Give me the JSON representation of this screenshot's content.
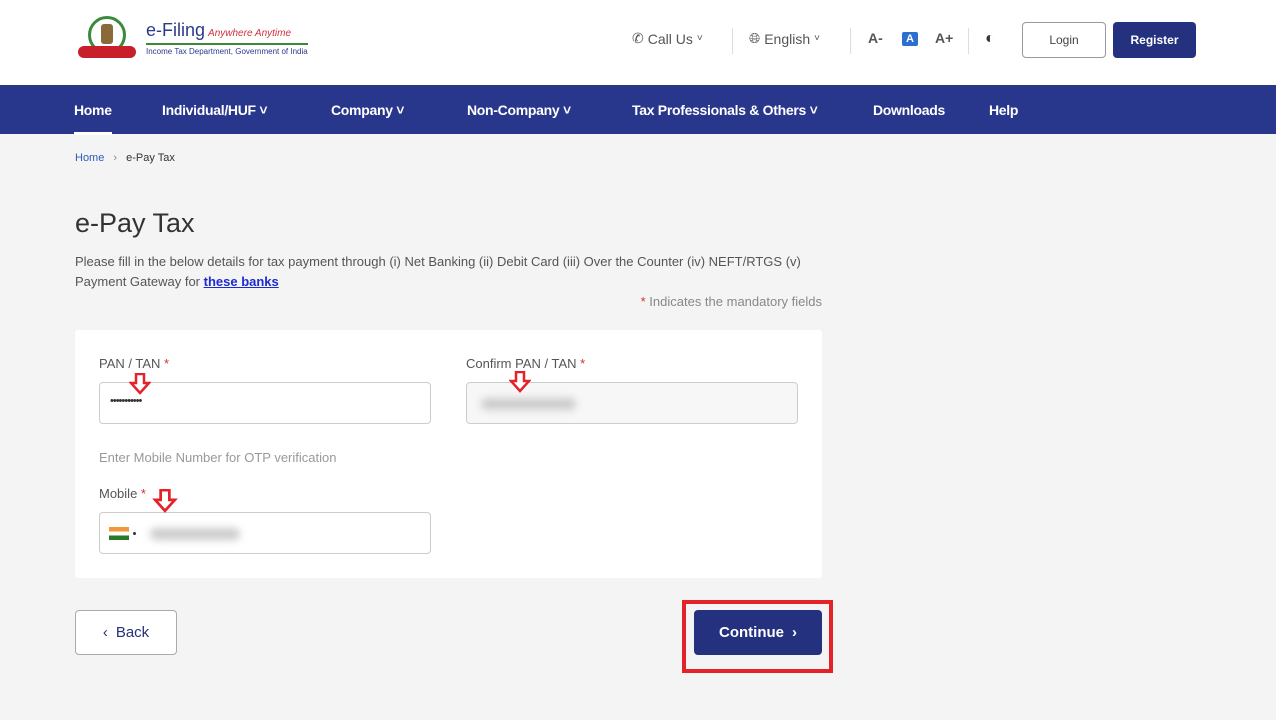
{
  "header": {
    "logo": {
      "brand": "e-Filing",
      "tagline": "Anywhere Anytime",
      "subtitle": "Income Tax Department, Government of India"
    },
    "call_us": "Call Us",
    "language": "English",
    "font_decrease": "A-",
    "font_normal": "A",
    "font_increase": "A+",
    "login_label": "Login",
    "register_label": "Register"
  },
  "nav": {
    "items": [
      {
        "label": "Home",
        "active": true
      },
      {
        "label": "Individual/HUF ˅"
      },
      {
        "label": "Company ˅"
      },
      {
        "label": "Non-Company ˅"
      },
      {
        "label": "Tax Professionals & Others ˅"
      },
      {
        "label": "Downloads"
      },
      {
        "label": "Help"
      }
    ]
  },
  "breadcrumb": {
    "home": "Home",
    "sep": "›",
    "current": "e-Pay Tax"
  },
  "page": {
    "title": "e-Pay Tax",
    "description": "Please fill in the below details for tax payment through (i) Net Banking (ii) Debit Card (iii) Over the Counter (iv) NEFT/RTGS (v) Payment Gateway for ",
    "link": "these banks",
    "mandatory_star": "*",
    "mandatory_note": " Indicates the mandatory fields"
  },
  "form": {
    "pan_label": "PAN / TAN",
    "pan_value": "•••••••••••",
    "confirm_pan_label": "Confirm PAN / TAN",
    "otp_hint": "Enter Mobile Number for OTP verification",
    "mobile_label": "Mobile",
    "required_star": "*"
  },
  "actions": {
    "back_label": "Back",
    "continue_label": "Continue"
  },
  "colors": {
    "primary": "#23317e",
    "nav": "#28378c",
    "annotation": "#e4222a"
  }
}
